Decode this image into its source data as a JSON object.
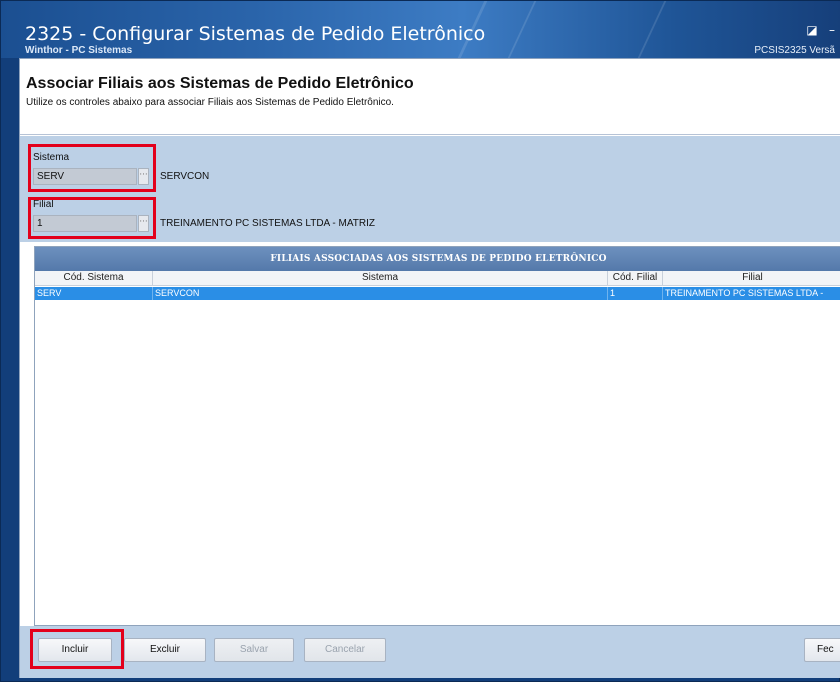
{
  "window": {
    "title": "2325 - Configurar Sistemas de Pedido Eletrônico",
    "subtitle": "Winthor - PC Sistemas",
    "right_info": "PCSIS2325  Versã",
    "restore_glyph": "◪",
    "minimize_glyph": "–"
  },
  "header": {
    "title": "Associar Filiais aos Sistemas de Pedido Eletrônico",
    "description": "Utilize os controles abaixo para associar Filiais aos Sistemas de Pedido Eletrônico."
  },
  "form": {
    "sistema_label": "Sistema",
    "sistema_value": "SERV",
    "sistema_desc": "SERVCON",
    "filial_label": "Filial",
    "filial_value": "1",
    "filial_desc": "TREINAMENTO PC SISTEMAS LTDA - MATRIZ",
    "lookup_glyph": "···"
  },
  "grid": {
    "title": "FILIAIS ASSOCIADAS AOS SISTEMAS DE PEDIDO ELETRÔNICO",
    "columns": [
      "Cód. Sistema",
      "Sistema",
      "Cód. Filial",
      "Filial"
    ],
    "rows": [
      [
        "SERV",
        "SERVCON",
        "1",
        "TREINAMENTO PC SISTEMAS LTDA -"
      ]
    ]
  },
  "buttons": {
    "incluir": "Incluir",
    "excluir": "Excluir",
    "salvar": "Salvar",
    "cancelar": "Cancelar",
    "fechar": "Fec"
  },
  "colors": {
    "highlight": "#e3001b",
    "selection": "#2a8ee6",
    "titlebar": "#2a64aa"
  }
}
